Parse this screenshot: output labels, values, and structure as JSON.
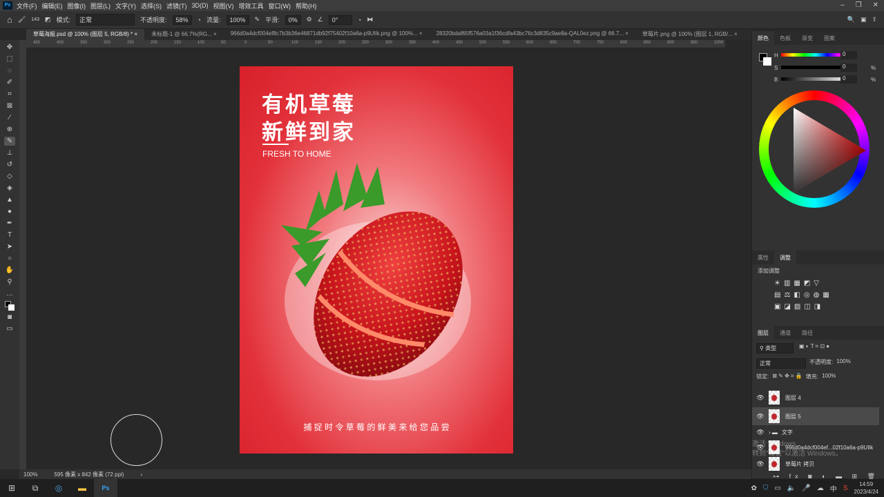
{
  "menu": [
    "文件(F)",
    "编辑(E)",
    "图像(I)",
    "图层(L)",
    "文字(Y)",
    "选择(S)",
    "滤镜(T)",
    "3D(D)",
    "视图(V)",
    "增效工具",
    "窗口(W)",
    "帮助(H)"
  ],
  "app_logo": "Ps",
  "options": {
    "brush_size": "143",
    "mode_label": "模式:",
    "mode": "正常",
    "opacity_label": "不透明度:",
    "opacity": "58%",
    "flow_label": "流量:",
    "flow": "100%",
    "smooth_label": "平滑:",
    "smooth": "0%",
    "angle": "0°"
  },
  "tabs": [
    "草莓海报.psd @ 100% (图层 5, RGB/8) *",
    "未标题-1 @ 66.7%(RG...",
    "966d0a4dcf004ef8c7b3b36e46871db92f75402f10a6a-p9UIlk.png @ 100%...",
    "28320bdaf65f576a03a1f36cdfa43bc76c3d835c9ae8a-QAL0ez.png @ 66.7...",
    "草莓片.png @ 100% (图层 1, RGB/..."
  ],
  "ruler": [
    "450",
    "400",
    "350",
    "300",
    "250",
    "200",
    "150",
    "100",
    "50",
    "0",
    "50",
    "100",
    "150",
    "200",
    "250",
    "300",
    "350",
    "400",
    "450",
    "500",
    "550",
    "600",
    "650",
    "700",
    "750",
    "800",
    "850",
    "900",
    "950",
    "1000"
  ],
  "poster": {
    "title1": "有机草莓",
    "title2": "新鲜到家",
    "subtitle": "FRESH TO HOME",
    "slogan": "捕 捉 时 令 草 莓 的 鲜 美 来 给 您 品 尝"
  },
  "status": {
    "zoom": "100%",
    "doc_size": "595 像素 x 842 像素 (72 ppi)"
  },
  "color_panel": {
    "tabs": [
      "颜色",
      "色板",
      "渐变",
      "图案"
    ],
    "h": "H",
    "s": "S",
    "b": "B",
    "h_val": "0",
    "s_val": "0",
    "b_val": "0",
    "pct": "%"
  },
  "adjust_panel": {
    "tabs": [
      "属性",
      "调整"
    ],
    "title": "添加调整"
  },
  "layers_panel": {
    "tabs": [
      "图层",
      "通道",
      "路径"
    ],
    "filter": "类型",
    "blend": "正常",
    "opacity_label": "不透明度:",
    "opacity": "100%",
    "lock_label": "锁定:",
    "fill_label": "填充:",
    "fill": "100%",
    "layers": [
      {
        "name": "图层 4"
      },
      {
        "name": "图层 5"
      },
      {
        "name": "文字"
      },
      {
        "name": "966d0a4dcf004ef...02f10a6a-p9UIlk"
      },
      {
        "name": "草莓片 拷贝"
      }
    ]
  },
  "watermark": "激活 Windows\n转到\"设置\"以激活 Windows。",
  "taskbar": {
    "time": "14:59",
    "date": "2023/4/24",
    "ime": "中"
  },
  "colors": {
    "accent": "#31a8ff",
    "poster_red": "#d7202a"
  }
}
